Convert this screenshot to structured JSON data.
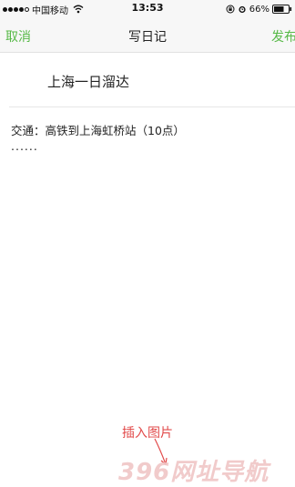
{
  "status_bar": {
    "carrier": "中国移动",
    "time": "13:53",
    "battery": "66%"
  },
  "nav": {
    "cancel_label": "取消",
    "title": "写日记",
    "publish_label": "发布"
  },
  "diary": {
    "title": "上海一日溜达",
    "body_lines": [
      "交通：高铁到上海虹桥站（10点）",
      "......"
    ]
  },
  "annotation": {
    "label": "插入图片"
  },
  "watermark": {
    "text": "396网址导航"
  },
  "colors": {
    "accent": "#57b947",
    "annotation": "#e24b4b",
    "nav_background": "#f7f7f7"
  },
  "icons": [
    "signal-dots-icon",
    "wifi-icon",
    "lock-rotation-icon",
    "alarm-icon",
    "battery-icon"
  ]
}
